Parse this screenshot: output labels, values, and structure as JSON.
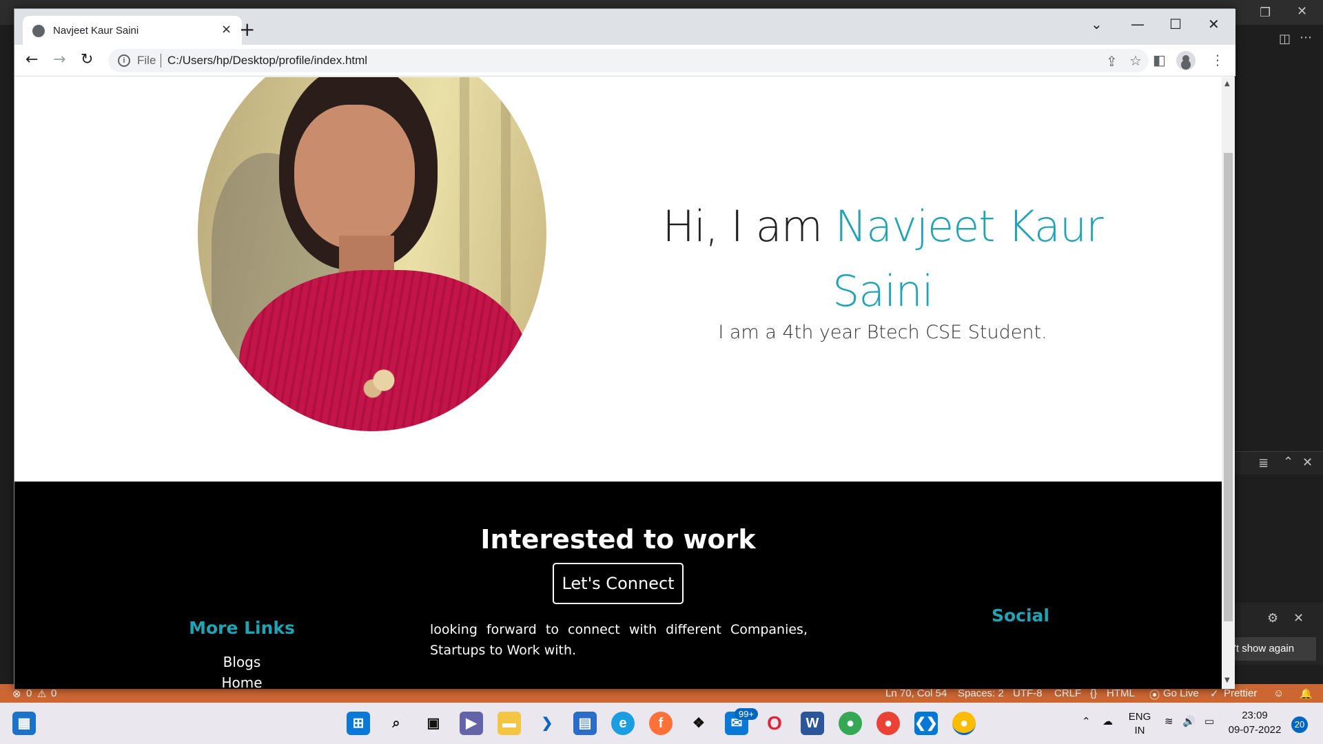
{
  "browser": {
    "tab_title": "Navjeet Kaur Saini",
    "omnibox_scheme": "File",
    "url": "C:/Users/hp/Desktop/profile/index.html",
    "new_tab_glyph": "+",
    "tab_close_glyph": "×"
  },
  "hero": {
    "greeting_prefix": "Hi, I am ",
    "name": "Navjeet Kaur Saini",
    "subtitle": "I am a 4th year Btech CSE Student.",
    "photo_alt": "profile-photo"
  },
  "footer": {
    "title": "Interested to work",
    "connect_button": "Let's Connect",
    "more_links_heading": "More Links",
    "links": [
      "Blogs",
      "Home"
    ],
    "description": "looking forward to connect with different Companies, Startups to Work with.",
    "social_heading": "Social"
  },
  "vscode": {
    "notification_button": "'t show again",
    "status": {
      "errors": "0",
      "warnings": "0",
      "position": "Ln 70, Col 54",
      "spaces": "Spaces: 2",
      "encoding": "UTF-8",
      "eol": "CRLF",
      "language": "HTML",
      "golive": "Go Live",
      "prettier": "Prettier"
    }
  },
  "taskbar": {
    "mail_badge": "99+",
    "language": "ENG",
    "region": "IN",
    "time": "23:09",
    "date": "09-07-2022",
    "notification_count": "20"
  },
  "colors": {
    "accent": "#1fa3b5",
    "statusbar": "#cc6633",
    "footer_bg": "#000000"
  }
}
